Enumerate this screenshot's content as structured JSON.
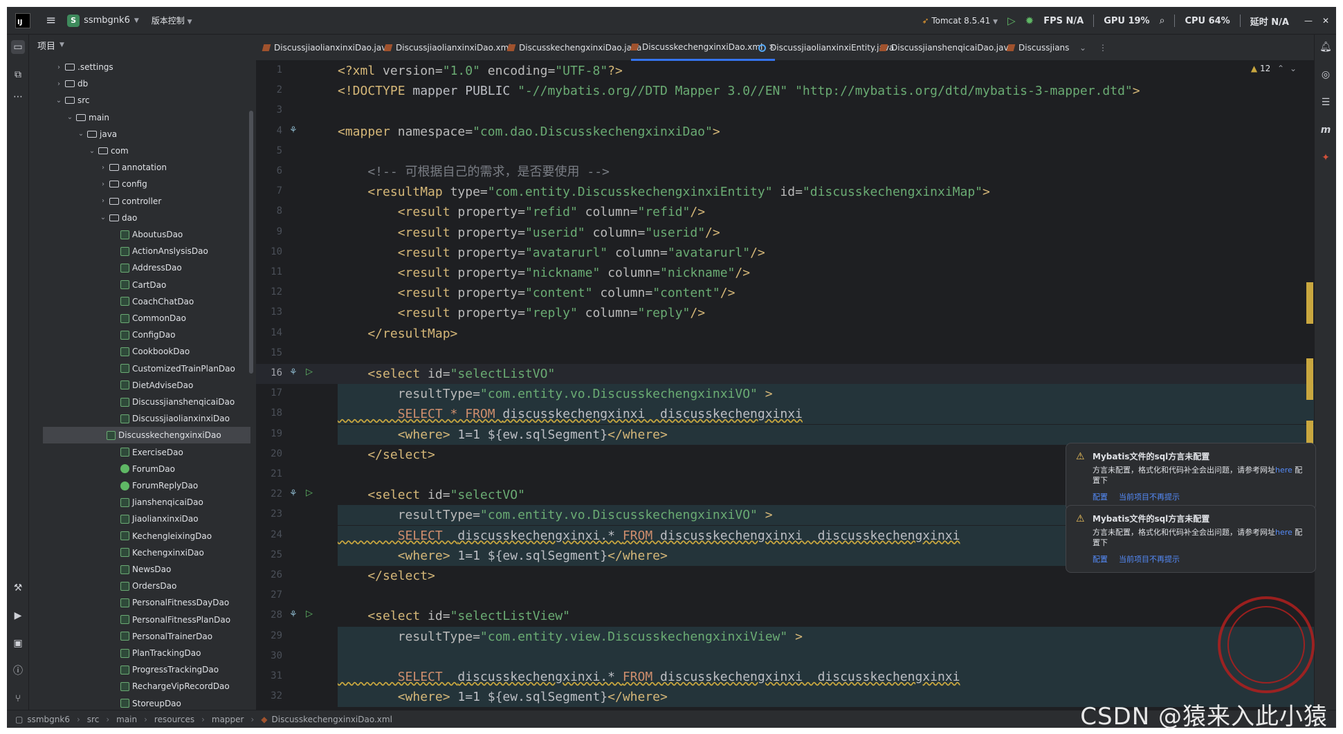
{
  "title_bar": {
    "project_badge": "S",
    "project_name": "ssmbgnk6",
    "vcs_label": "版本控制",
    "run_config": "Tomcat 8.5.41",
    "fps": "FPS N/A",
    "gpu": "GPU 19%",
    "cpu": "CPU 64%",
    "time": "延时 N/A"
  },
  "project_panel": {
    "title": "项目",
    "tree": [
      {
        "label": ".settings",
        "depth": 1,
        "type": "folder",
        "expanded": false
      },
      {
        "label": "db",
        "depth": 1,
        "type": "folder",
        "expanded": false
      },
      {
        "label": "src",
        "depth": 1,
        "type": "folder",
        "expanded": true
      },
      {
        "label": "main",
        "depth": 2,
        "type": "folder",
        "expanded": true
      },
      {
        "label": "java",
        "depth": 3,
        "type": "folder",
        "expanded": true
      },
      {
        "label": "com",
        "depth": 4,
        "type": "folder",
        "expanded": true
      },
      {
        "label": "annotation",
        "depth": 5,
        "type": "folder",
        "expanded": false
      },
      {
        "label": "config",
        "depth": 5,
        "type": "folder",
        "expanded": false
      },
      {
        "label": "controller",
        "depth": 5,
        "type": "folder",
        "expanded": false
      },
      {
        "label": "dao",
        "depth": 5,
        "type": "folder",
        "expanded": true
      },
      {
        "label": "AboutusDao",
        "depth": 6,
        "type": "mybatis"
      },
      {
        "label": "ActionAnslysisDao",
        "depth": 6,
        "type": "mybatis"
      },
      {
        "label": "AddressDao",
        "depth": 6,
        "type": "mybatis"
      },
      {
        "label": "CartDao",
        "depth": 6,
        "type": "mybatis"
      },
      {
        "label": "CoachChatDao",
        "depth": 6,
        "type": "mybatis"
      },
      {
        "label": "CommonDao",
        "depth": 6,
        "type": "mybatis"
      },
      {
        "label": "ConfigDao",
        "depth": 6,
        "type": "mybatis"
      },
      {
        "label": "CookbookDao",
        "depth": 6,
        "type": "mybatis"
      },
      {
        "label": "CustomizedTrainPlanDao",
        "depth": 6,
        "type": "mybatis"
      },
      {
        "label": "DietAdviseDao",
        "depth": 6,
        "type": "mybatis"
      },
      {
        "label": "DiscussjianshenqicaiDao",
        "depth": 6,
        "type": "mybatis"
      },
      {
        "label": "DiscussjiaolianxinxiDao",
        "depth": 6,
        "type": "mybatis"
      },
      {
        "label": "DiscusskechengxinxiDao",
        "depth": 6,
        "type": "mybatis",
        "selected": true
      },
      {
        "label": "ExerciseDao",
        "depth": 6,
        "type": "mybatis"
      },
      {
        "label": "ForumDao",
        "depth": 6,
        "type": "interface"
      },
      {
        "label": "ForumReplyDao",
        "depth": 6,
        "type": "interface"
      },
      {
        "label": "JianshenqicaiDao",
        "depth": 6,
        "type": "mybatis"
      },
      {
        "label": "JiaolianxinxiDao",
        "depth": 6,
        "type": "mybatis"
      },
      {
        "label": "KechengleixingDao",
        "depth": 6,
        "type": "mybatis"
      },
      {
        "label": "KechengxinxiDao",
        "depth": 6,
        "type": "mybatis"
      },
      {
        "label": "NewsDao",
        "depth": 6,
        "type": "mybatis"
      },
      {
        "label": "OrdersDao",
        "depth": 6,
        "type": "mybatis"
      },
      {
        "label": "PersonalFitnessDayDao",
        "depth": 6,
        "type": "mybatis"
      },
      {
        "label": "PersonalFitnessPlanDao",
        "depth": 6,
        "type": "mybatis"
      },
      {
        "label": "PersonalTrainerDao",
        "depth": 6,
        "type": "mybatis"
      },
      {
        "label": "PlanTrackingDao",
        "depth": 6,
        "type": "mybatis"
      },
      {
        "label": "ProgressTrackingDao",
        "depth": 6,
        "type": "mybatis"
      },
      {
        "label": "RechargeVipRecordDao",
        "depth": 6,
        "type": "mybatis"
      },
      {
        "label": "StoreupDao",
        "depth": 6,
        "type": "mybatis"
      }
    ]
  },
  "tabs": [
    {
      "label": "DiscussjiaolianxinxiDao.java",
      "icon": "mybatis"
    },
    {
      "label": "DiscussjiaolianxinxiDao.xml",
      "icon": "mybatis"
    },
    {
      "label": "DiscusskechengxinxiDao.java",
      "icon": "mybatis"
    },
    {
      "label": "DiscusskechengxinxiDao.xml",
      "icon": "mybatis",
      "active": true
    },
    {
      "label": "DiscussjiaolianxinxiEntity.java",
      "icon": "entity"
    },
    {
      "label": "DiscussjianshenqicaiDao.java",
      "icon": "mybatis"
    },
    {
      "label": "Discussjians",
      "icon": "mybatis"
    }
  ],
  "editor": {
    "inspection_count": "12",
    "current_line": 16,
    "lines": [
      [
        {
          "c": "t-pi",
          "t": "<?xml "
        },
        {
          "c": "t-attr",
          "t": "version="
        },
        {
          "c": "t-val",
          "t": "\"1.0\""
        },
        {
          "c": "t-attr",
          "t": " encoding="
        },
        {
          "c": "t-val",
          "t": "\"UTF-8\""
        },
        {
          "c": "t-pi",
          "t": "?>"
        }
      ],
      [
        {
          "c": "t-tag",
          "t": "<!DOCTYPE "
        },
        {
          "c": "t-txt",
          "t": "mapper PUBLIC "
        },
        {
          "c": "t-val",
          "t": "\"-//mybatis.org//DTD Mapper 3.0//EN\""
        },
        {
          "c": "t-txt",
          "t": " "
        },
        {
          "c": "t-val",
          "t": "\"http://mybatis.org/dtd/mybatis-3-mapper.dtd\""
        },
        {
          "c": "t-tag",
          "t": ">"
        }
      ],
      [],
      [
        {
          "c": "t-tag",
          "t": "<mapper "
        },
        {
          "c": "t-attr",
          "t": "namespace="
        },
        {
          "c": "t-val",
          "t": "\"com.dao.DiscusskechengxinxiDao\""
        },
        {
          "c": "t-tag",
          "t": ">"
        }
      ],
      [],
      [
        {
          "c": "t-com",
          "t": "    <!-- 可根据自己的需求，是否要使用 -->"
        }
      ],
      [
        {
          "c": "t-tag",
          "t": "    <resultMap "
        },
        {
          "c": "t-attr",
          "t": "type="
        },
        {
          "c": "t-val",
          "t": "\"com.entity.DiscusskechengxinxiEntity\""
        },
        {
          "c": "t-attr",
          "t": " id="
        },
        {
          "c": "t-val",
          "t": "\"discusskechengxinxiMap\""
        },
        {
          "c": "t-tag",
          "t": ">"
        }
      ],
      [
        {
          "c": "t-tag",
          "t": "        <result "
        },
        {
          "c": "t-attr",
          "t": "property="
        },
        {
          "c": "t-val",
          "t": "\"refid\""
        },
        {
          "c": "t-attr",
          "t": " column="
        },
        {
          "c": "t-val",
          "t": "\"refid\""
        },
        {
          "c": "t-tag",
          "t": "/>"
        }
      ],
      [
        {
          "c": "t-tag",
          "t": "        <result "
        },
        {
          "c": "t-attr",
          "t": "property="
        },
        {
          "c": "t-val",
          "t": "\"userid\""
        },
        {
          "c": "t-attr",
          "t": " column="
        },
        {
          "c": "t-val",
          "t": "\"userid\""
        },
        {
          "c": "t-tag",
          "t": "/>"
        }
      ],
      [
        {
          "c": "t-tag",
          "t": "        <result "
        },
        {
          "c": "t-attr",
          "t": "property="
        },
        {
          "c": "t-val",
          "t": "\"avatarurl\""
        },
        {
          "c": "t-attr",
          "t": " column="
        },
        {
          "c": "t-val",
          "t": "\"avatarurl\""
        },
        {
          "c": "t-tag",
          "t": "/>"
        }
      ],
      [
        {
          "c": "t-tag",
          "t": "        <result "
        },
        {
          "c": "t-attr",
          "t": "property="
        },
        {
          "c": "t-val",
          "t": "\"nickname\""
        },
        {
          "c": "t-attr",
          "t": " column="
        },
        {
          "c": "t-val",
          "t": "\"nickname\""
        },
        {
          "c": "t-tag",
          "t": "/>"
        }
      ],
      [
        {
          "c": "t-tag",
          "t": "        <result "
        },
        {
          "c": "t-attr",
          "t": "property="
        },
        {
          "c": "t-val",
          "t": "\"content\""
        },
        {
          "c": "t-attr",
          "t": " column="
        },
        {
          "c": "t-val",
          "t": "\"content\""
        },
        {
          "c": "t-tag",
          "t": "/>"
        }
      ],
      [
        {
          "c": "t-tag",
          "t": "        <result "
        },
        {
          "c": "t-attr",
          "t": "property="
        },
        {
          "c": "t-val",
          "t": "\"reply\""
        },
        {
          "c": "t-attr",
          "t": " column="
        },
        {
          "c": "t-val",
          "t": "\"reply\""
        },
        {
          "c": "t-tag",
          "t": "/>"
        }
      ],
      [
        {
          "c": "t-tag",
          "t": "    </resultMap>"
        }
      ],
      [],
      [
        {
          "c": "t-tag",
          "t": "    <select "
        },
        {
          "c": "t-attr",
          "t": "id="
        },
        {
          "c": "t-val",
          "t": "\"selectListVO\""
        }
      ],
      [
        {
          "c": "t-attr",
          "t": "        resultType="
        },
        {
          "c": "t-val",
          "t": "\"com.entity.vo.DiscusskechengxinxiVO\""
        },
        {
          "c": "t-tag",
          "t": " >"
        }
      ],
      [
        {
          "c": "t-kw",
          "t": "        SELECT * FROM "
        },
        {
          "c": "t-txt",
          "t": "discusskechengxinxi  discusskechengxinxi"
        }
      ],
      [
        {
          "c": "t-tag",
          "t": "        <where>"
        },
        {
          "c": "t-txt",
          "t": " 1=1 ${ew.sqlSegment}"
        },
        {
          "c": "t-tag",
          "t": "</where>"
        }
      ],
      [
        {
          "c": "t-tag",
          "t": "    </select>"
        }
      ],
      [],
      [
        {
          "c": "t-tag",
          "t": "    <select "
        },
        {
          "c": "t-attr",
          "t": "id="
        },
        {
          "c": "t-val",
          "t": "\"selectVO\""
        }
      ],
      [
        {
          "c": "t-attr",
          "t": "        resultType="
        },
        {
          "c": "t-val",
          "t": "\"com.entity.vo.DiscusskechengxinxiVO\""
        },
        {
          "c": "t-tag",
          "t": " >"
        }
      ],
      [
        {
          "c": "t-kw",
          "t": "        SELECT  "
        },
        {
          "c": "t-txt",
          "t": "discusskechengxinxi.* "
        },
        {
          "c": "t-kw",
          "t": "FROM "
        },
        {
          "c": "t-txt",
          "t": "discusskechengxinxi  discusskechengxinxi"
        }
      ],
      [
        {
          "c": "t-tag",
          "t": "        <where>"
        },
        {
          "c": "t-txt",
          "t": " 1=1 ${ew.sqlSegment}"
        },
        {
          "c": "t-tag",
          "t": "</where>"
        }
      ],
      [
        {
          "c": "t-tag",
          "t": "    </select>"
        }
      ],
      [],
      [
        {
          "c": "t-tag",
          "t": "    <select "
        },
        {
          "c": "t-attr",
          "t": "id="
        },
        {
          "c": "t-val",
          "t": "\"selectListView\""
        }
      ],
      [
        {
          "c": "t-attr",
          "t": "        resultType="
        },
        {
          "c": "t-val",
          "t": "\"com.entity.view.DiscusskechengxinxiView\""
        },
        {
          "c": "t-tag",
          "t": " >"
        }
      ],
      [],
      [
        {
          "c": "t-kw",
          "t": "        SELECT  "
        },
        {
          "c": "t-txt",
          "t": "discusskechengxinxi.* "
        },
        {
          "c": "t-kw",
          "t": "FROM "
        },
        {
          "c": "t-txt",
          "t": "discusskechengxinxi  discusskechengxinxi"
        }
      ],
      [
        {
          "c": "t-tag",
          "t": "        <where>"
        },
        {
          "c": "t-txt",
          "t": " 1=1 ${ew.sqlSegment}"
        },
        {
          "c": "t-tag",
          "t": "</where>"
        }
      ]
    ],
    "highlighted_lines": [
      17,
      18,
      19,
      23,
      24,
      25,
      29,
      30,
      31,
      32
    ],
    "gutter_icon_lines": [
      4,
      16,
      22,
      28
    ],
    "run_icon_lines": [
      16,
      22,
      28
    ]
  },
  "notifications": [
    {
      "title": "Mybatis文件的sql方言未配置",
      "body_prefix": "方言未配置，格式化和代码补全会出问题，请参考网址",
      "link": "here",
      "body_suffix": " 配置下",
      "action1": "配置",
      "action2": "当前项目不再提示"
    },
    {
      "title": "Mybatis文件的sql方言未配置",
      "body_prefix": "方言未配置，格式化和代码补全会出问题，请参考网址",
      "link": "here",
      "body_suffix": " 配置下",
      "action1": "配置",
      "action2": "当前项目不再提示"
    }
  ],
  "status_bar": {
    "breadcrumbs": [
      "ssmbgnk6",
      "src",
      "main",
      "resources",
      "mapper",
      "DiscusskechengxinxiDao.xml"
    ]
  },
  "watermark": "CSDN @猿来入此小猿",
  "colors": {
    "accent": "#3574f0",
    "tag": "#d5b778",
    "string": "#6aab73",
    "keyword": "#cf8e6d",
    "comment": "#7a7e85",
    "warning": "#c9a73f",
    "background": "#1e1f22",
    "panel": "#2b2d30"
  }
}
